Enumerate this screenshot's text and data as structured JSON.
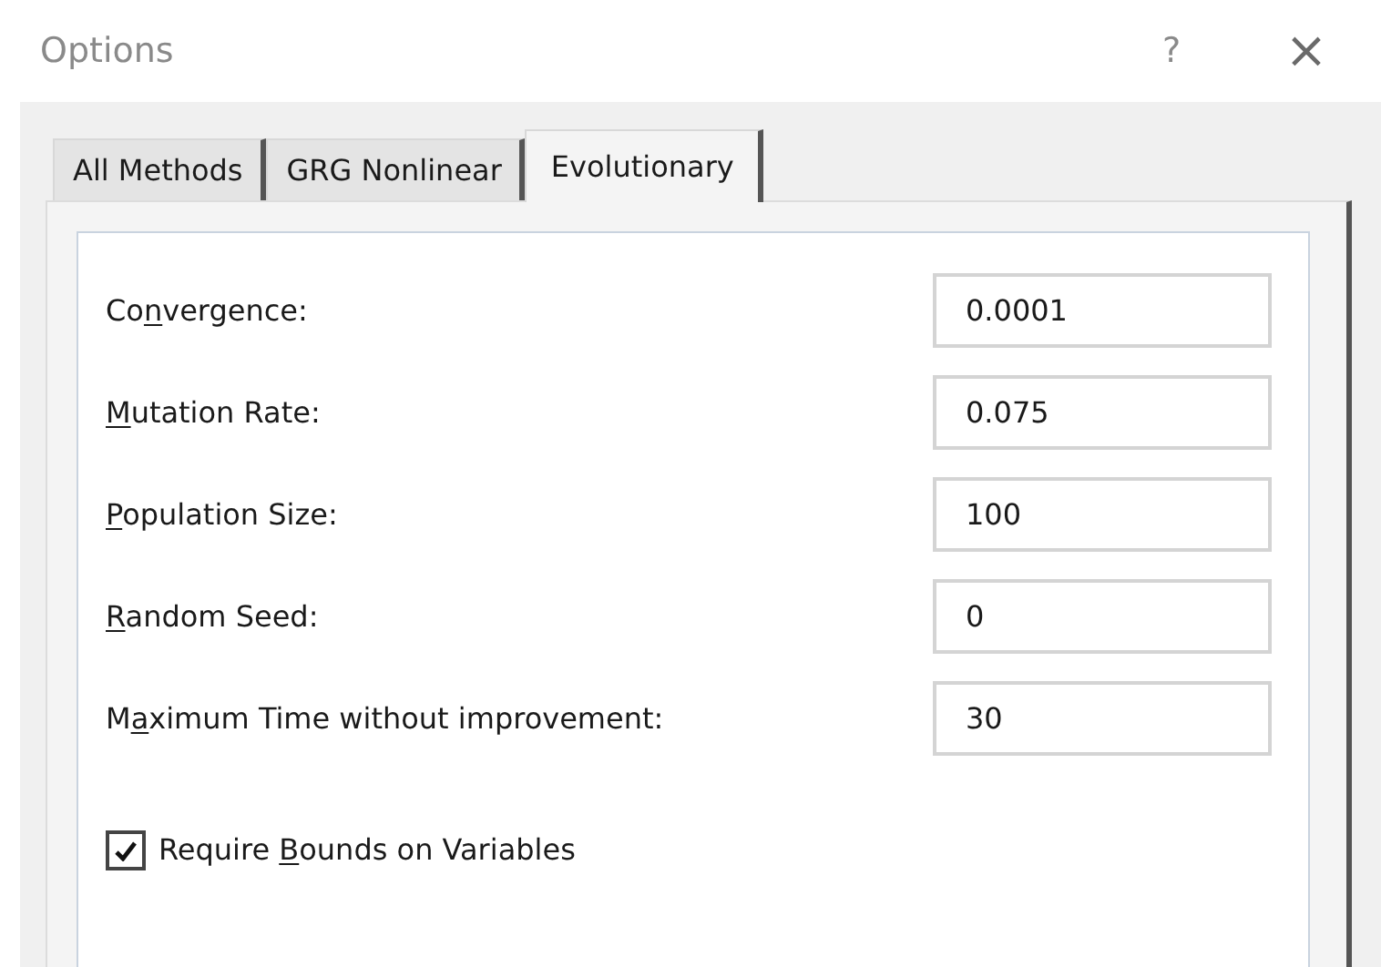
{
  "window": {
    "title": "Options",
    "help": "?",
    "close": "×"
  },
  "tabs": [
    {
      "label": "All Methods",
      "selected": false
    },
    {
      "label": "GRG Nonlinear",
      "selected": false
    },
    {
      "label": "Evolutionary",
      "selected": true
    }
  ],
  "fields": [
    {
      "before": "Co",
      "access_key": "n",
      "after": "vergence:",
      "value": "0.0001"
    },
    {
      "access_key": "M",
      "after": "utation Rate:",
      "value": "0.075"
    },
    {
      "access_key": "P",
      "after": "opulation Size:",
      "value": "100"
    },
    {
      "access_key": "R",
      "after": "andom Seed:",
      "value": "0"
    },
    {
      "before": "M",
      "access_key": "a",
      "after": "ximum Time without improvement:",
      "value": "30"
    }
  ],
  "checkbox": {
    "before": "Require ",
    "access_key": "B",
    "after": "ounds on Variables",
    "checked": true
  }
}
